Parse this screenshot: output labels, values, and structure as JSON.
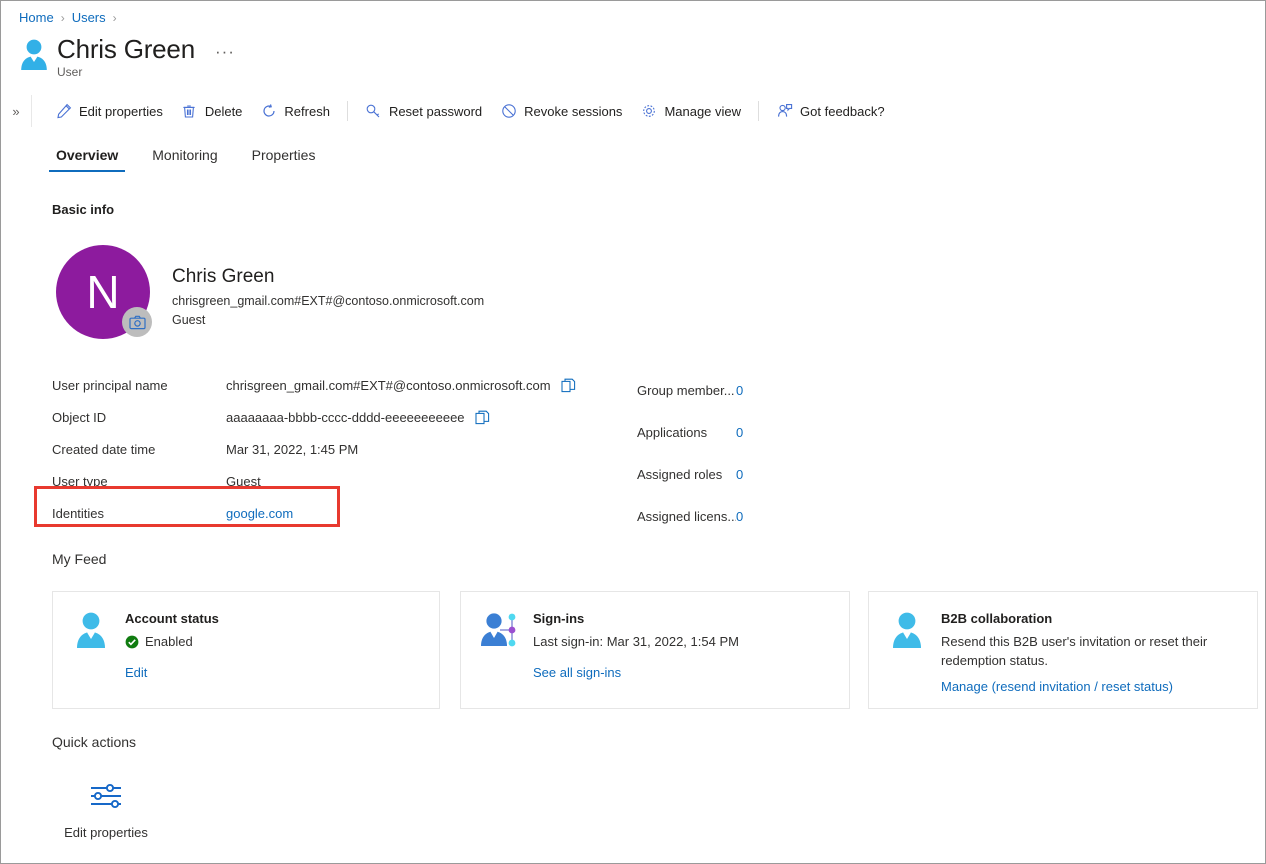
{
  "breadcrumb": {
    "items": [
      {
        "label": "Home",
        "icon": ""
      },
      {
        "label": "Users",
        "icon": ""
      }
    ],
    "separator": "›"
  },
  "header": {
    "title": "Chris Green",
    "subtitle": "User",
    "icon": "user-icon",
    "ellipsis": "···"
  },
  "commandbar": {
    "expand_icon": "»",
    "buttons": [
      {
        "label": "Edit properties",
        "icon": "pencil-icon"
      },
      {
        "label": "Delete",
        "icon": "trash-icon"
      },
      {
        "label": "Refresh",
        "icon": "refresh-icon"
      },
      {
        "label": "Reset password",
        "icon": "key-icon"
      },
      {
        "label": "Revoke sessions",
        "icon": "block-icon"
      },
      {
        "label": "Manage view",
        "icon": "gear-icon"
      },
      {
        "label": "Got feedback?",
        "icon": "feedback-icon"
      }
    ]
  },
  "tabs": [
    {
      "label": "Overview",
      "active": true
    },
    {
      "label": "Monitoring",
      "active": false
    },
    {
      "label": "Properties",
      "active": false
    }
  ],
  "sections": {
    "basic_info": "Basic info",
    "my_feed": "My Feed",
    "quick_actions": "Quick actions"
  },
  "profile": {
    "avatar_initial": "N",
    "avatar_color": "#8d1b9e",
    "camera_icon": "camera-icon",
    "name": "Chris Green",
    "upn": "chrisgreen_gmail.com#EXT#@contoso.onmicrosoft.com",
    "user_type": "Guest"
  },
  "properties": [
    {
      "label": "User principal name",
      "value": "chrisgreen_gmail.com#EXT#@contoso.onmicrosoft.com",
      "copy": true,
      "link": false
    },
    {
      "label": "Object ID",
      "value": "aaaaaaaa-bbbb-cccc-dddd-eeeeeeeeeee",
      "copy": true,
      "link": false
    },
    {
      "label": "Created date time",
      "value": "Mar 31, 2022, 1:45 PM",
      "copy": false,
      "link": false
    },
    {
      "label": "User type",
      "value": "Guest",
      "copy": false,
      "link": false
    },
    {
      "label": "Identities",
      "value": "google.com",
      "copy": false,
      "link": true
    }
  ],
  "stats": [
    {
      "label": "Group member...",
      "value": "0"
    },
    {
      "label": "Applications",
      "value": "0"
    },
    {
      "label": "Assigned roles",
      "value": "0"
    },
    {
      "label": "Assigned licens...",
      "value": "0"
    }
  ],
  "feed_cards": [
    {
      "icon": "user-status-icon",
      "title": "Account status",
      "status_icon": "check-circle-icon",
      "status_text": "Enabled",
      "description": "",
      "link": "Edit"
    },
    {
      "icon": "sign-ins-icon",
      "title": "Sign-ins",
      "status_icon": "",
      "status_text": "",
      "description": "Last sign-in: Mar 31, 2022, 1:54 PM",
      "link": "See all sign-ins"
    },
    {
      "icon": "b2b-user-icon",
      "title": "B2B collaboration",
      "status_icon": "",
      "status_text": "",
      "description": "Resend this B2B user's invitation or reset their redemption status.",
      "link": "Manage (resend invitation / reset status)"
    }
  ],
  "quick_actions": [
    {
      "label": "Edit properties",
      "icon": "sliders-icon"
    }
  ],
  "colors": {
    "link": "#0f6cbd",
    "accent": "#0f6cbd",
    "highlight_border": "#e8392f",
    "status_enabled": "#107c10",
    "avatar": "#8d1b9e"
  }
}
